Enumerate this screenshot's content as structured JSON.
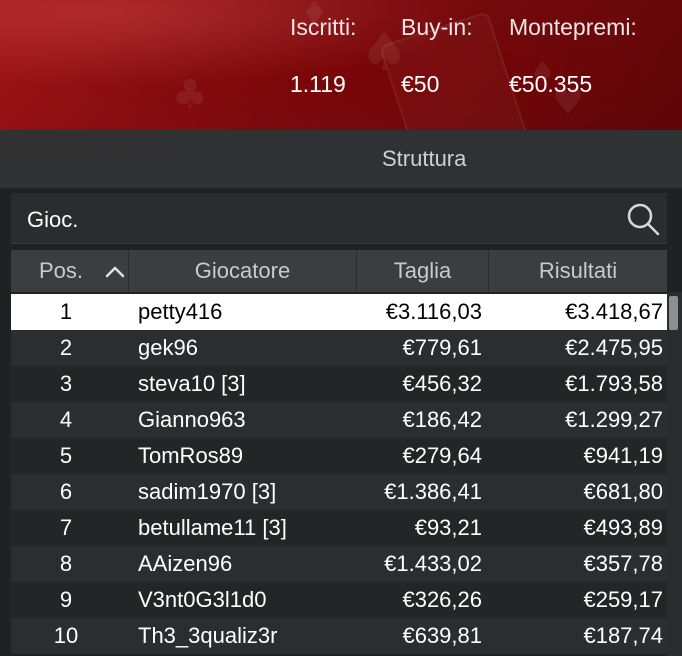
{
  "header": {
    "stats": [
      {
        "label": "Iscritti:",
        "value": "1.119"
      },
      {
        "label": "Buy-in:",
        "value": "€50"
      },
      {
        "label": "Montepremi:",
        "value": "€50.355"
      }
    ]
  },
  "tabs": {
    "active": "Struttura"
  },
  "search": {
    "text": "Gioc."
  },
  "table": {
    "columns": [
      "Pos.",
      "Giocatore",
      "Taglia",
      "Risultati"
    ],
    "sort": {
      "column": "Pos.",
      "direction": "ascending"
    },
    "rows": [
      {
        "pos": "1",
        "player": "petty416",
        "stack": "€3.116,03",
        "result": "€3.418,67"
      },
      {
        "pos": "2",
        "player": "gek96",
        "stack": "€779,61",
        "result": "€2.475,95"
      },
      {
        "pos": "3",
        "player": "steva10 [3]",
        "stack": "€456,32",
        "result": "€1.793,58"
      },
      {
        "pos": "4",
        "player": "Gianno963",
        "stack": "€186,42",
        "result": "€1.299,27"
      },
      {
        "pos": "5",
        "player": "TomRos89",
        "stack": "€279,64",
        "result": "€941,19"
      },
      {
        "pos": "6",
        "player": "sadim1970 [3]",
        "stack": "€1.386,41",
        "result": "€681,80"
      },
      {
        "pos": "7",
        "player": "betullame11 [3]",
        "stack": "€93,21",
        "result": "€493,89"
      },
      {
        "pos": "8",
        "player": "AAizen96",
        "stack": "€1.433,02",
        "result": "€357,78"
      },
      {
        "pos": "9",
        "player": "V3nt0G3l1d0",
        "stack": "€326,26",
        "result": "€259,17"
      },
      {
        "pos": "10",
        "player": "Th3_3qualiz3r",
        "stack": "€639,81",
        "result": "€187,74"
      }
    ]
  },
  "colors": {
    "header_red": "#9e1416",
    "selected_row_bg": "#ffffff",
    "row_even_bg": "#2b2d30",
    "row_odd_bg": "#232527"
  }
}
